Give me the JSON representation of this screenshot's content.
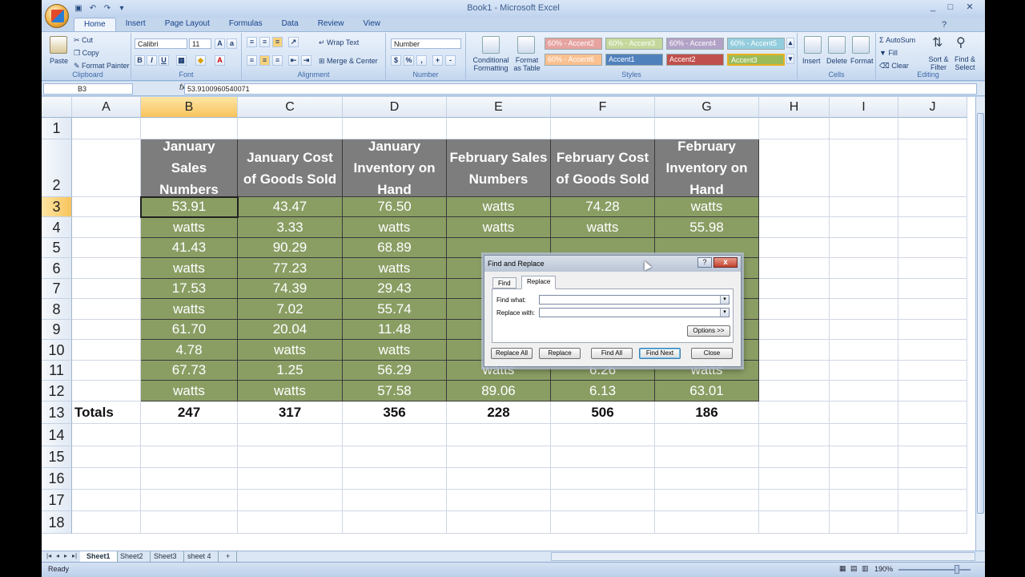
{
  "window": {
    "title": "Book1 - Microsoft Excel"
  },
  "tabs": [
    "Home",
    "Insert",
    "Page Layout",
    "Formulas",
    "Data",
    "Review",
    "View"
  ],
  "ribbon": {
    "clipboard": {
      "label": "Clipboard",
      "paste": "Paste",
      "cut": "Cut",
      "copy": "Copy",
      "format_painter": "Format Painter"
    },
    "font": {
      "label": "Font",
      "name": "Calibri",
      "size": "11"
    },
    "alignment": {
      "label": "Alignment",
      "wrap": "Wrap Text",
      "merge": "Merge & Center"
    },
    "number": {
      "label": "Number",
      "format": "Number"
    },
    "styles": {
      "label": "Styles",
      "cond": "Conditional Formatting",
      "table": "Format as Table",
      "cells": [
        {
          "text": "60% - Accent2",
          "color": "#e6a3a0"
        },
        {
          "text": "60% - Accent3",
          "color": "#c5d89b"
        },
        {
          "text": "60% - Accent4",
          "color": "#b3a2c7"
        },
        {
          "text": "60% - Accent5",
          "color": "#93cddd"
        },
        {
          "text": "60% - Accent6",
          "color": "#fac090"
        },
        {
          "text": "Accent1",
          "color": "#4f81bd"
        },
        {
          "text": "Accent2",
          "color": "#c0504d"
        },
        {
          "text": "Accent3",
          "color": "#9bbb59"
        }
      ]
    },
    "cells": {
      "label": "Cells",
      "insert": "Insert",
      "delete": "Delete",
      "format": "Format"
    },
    "editing": {
      "label": "Editing",
      "autosum": "AutoSum",
      "fill": "Fill",
      "clear": "Clear",
      "sort": "Sort & Filter",
      "find": "Find & Select"
    }
  },
  "formula_bar": {
    "name_box": "B3",
    "fx": "fx",
    "value": "53.9100960540071"
  },
  "columns": [
    "A",
    "B",
    "C",
    "D",
    "E",
    "F",
    "G",
    "H",
    "I",
    "J"
  ],
  "rows": [
    "1",
    "2",
    "3",
    "4",
    "5",
    "6",
    "7",
    "8",
    "9",
    "10",
    "11",
    "12",
    "13",
    "14",
    "15",
    "16",
    "17",
    "18"
  ],
  "headers": [
    "January Sales Numbers",
    "January Cost of Goods Sold",
    "January Inventory on Hand",
    "February Sales Numbers",
    "February Cost of Goods Sold",
    "February Inventory on Hand"
  ],
  "data": [
    [
      "53.91",
      "43.47",
      "76.50",
      "watts",
      "74.28",
      "watts"
    ],
    [
      "watts",
      "3.33",
      "watts",
      "watts",
      "watts",
      "55.98"
    ],
    [
      "41.43",
      "90.29",
      "68.89",
      "",
      "",
      ""
    ],
    [
      "watts",
      "77.23",
      "watts",
      "",
      "",
      ""
    ],
    [
      "17.53",
      "74.39",
      "29.43",
      "",
      "",
      ""
    ],
    [
      "watts",
      "7.02",
      "55.74",
      "",
      "",
      ""
    ],
    [
      "61.70",
      "20.04",
      "11.48",
      "",
      "",
      ""
    ],
    [
      "4.78",
      "watts",
      "watts",
      "",
      "",
      ""
    ],
    [
      "67.73",
      "1.25",
      "56.29",
      "watts",
      "6.26",
      "watts"
    ],
    [
      "watts",
      "watts",
      "57.58",
      "89.06",
      "6.13",
      "63.01"
    ]
  ],
  "totals": {
    "label": "Totals",
    "values": [
      "247",
      "317",
      "356",
      "228",
      "506",
      "186"
    ]
  },
  "sheets": [
    "Sheet1",
    "Sheet2",
    "Sheet3",
    "sheet 4"
  ],
  "status": {
    "text": "Ready",
    "zoom": "190%"
  },
  "dialog": {
    "title": "Find and Replace",
    "help": "?",
    "close": "x",
    "tab_find": "Find",
    "tab_replace": "Replace",
    "find_label": "Find what:",
    "replace_label": "Replace with:",
    "options": "Options >>",
    "replace_all": "Replace All",
    "replace": "Replace",
    "find_all": "Find All",
    "find_next": "Find Next",
    "close_btn": "Close"
  }
}
